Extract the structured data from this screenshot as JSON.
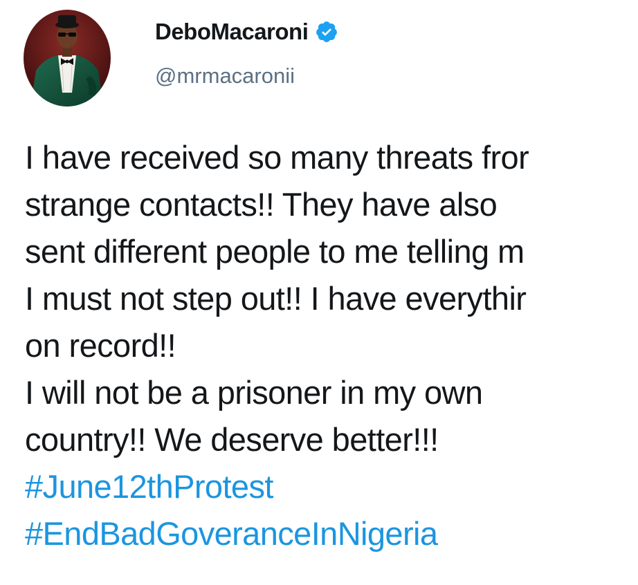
{
  "tweet": {
    "author": {
      "display_name": "DeboMacaroni",
      "handle": "@mrmacaronii",
      "avatar_icon": "profile-photo",
      "verified_icon": "verified-badge-icon",
      "verified_color": "#1da1f2"
    },
    "text_lines": [
      "I have received so many threats fror",
      "strange contacts!! They have also",
      "sent different people to me telling m",
      "I must not step out!! I have everythir",
      "on record!!",
      "I will not be a prisoner in my own",
      "country!! We deserve better!!!"
    ],
    "hashtags": [
      "#June12thProtest",
      "#EndBadGoveranceInNigeria"
    ],
    "colors": {
      "text": "#14171a",
      "handle": "#5b7083",
      "hashtag": "#1b95e0"
    }
  }
}
